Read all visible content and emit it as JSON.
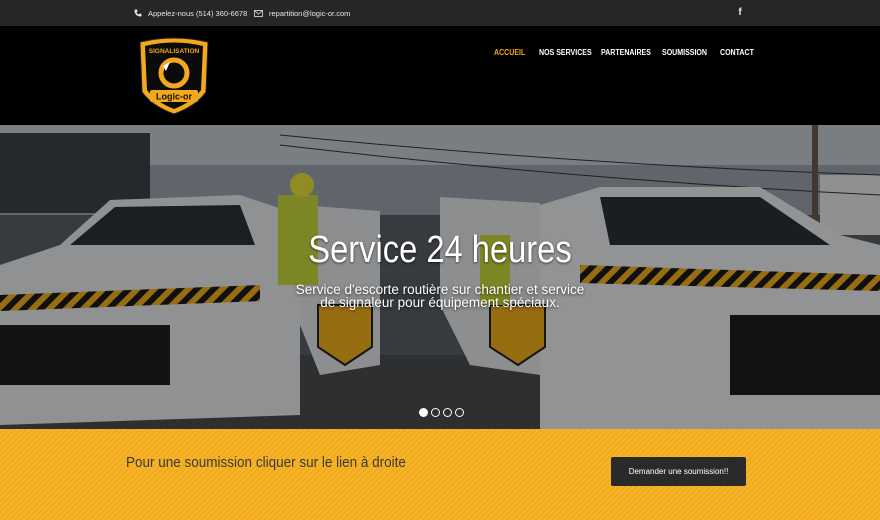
{
  "topbar": {
    "phone_icon": "phone-icon",
    "phone_text": "Appelez-nous (514) 360-6678",
    "email_icon": "envelope-icon",
    "email_text": "repartition@logic-or.com",
    "social_icon": "facebook-icon",
    "social_label": "f"
  },
  "logo": {
    "top_text": "SIGNALISATION",
    "bottom_text": "Logic-or",
    "colors": {
      "badge": "#f4a81d",
      "badge_inner": "#000000"
    }
  },
  "nav": {
    "items": [
      {
        "label": "ACCUEIL",
        "active": true
      },
      {
        "label": "NOS SERVICES",
        "active": false
      },
      {
        "label": "PARTENAIRES",
        "active": false
      },
      {
        "label": "SOUMISSION",
        "active": false
      },
      {
        "label": "CONTACT",
        "active": false
      }
    ],
    "active_color": "#f4a81d"
  },
  "hero": {
    "title": "Service 24 heures",
    "subtitle": "Service d'escorte routière sur chantier et service de signaleur pour équipement spéciaux.",
    "slides_total": 4,
    "active_slide": 1
  },
  "cta": {
    "text": "Pour une soumission cliquer sur le lien à droite",
    "button_label": "Demander une soumission!!",
    "background": "#f8b01e"
  }
}
